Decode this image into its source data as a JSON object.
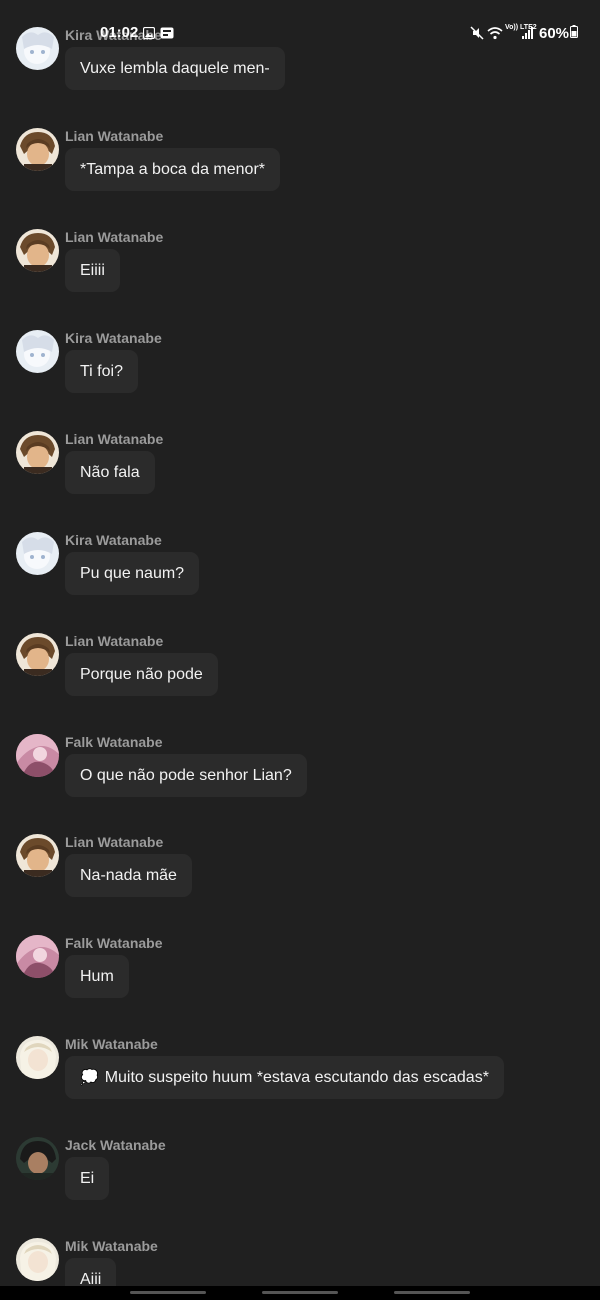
{
  "status_bar": {
    "time": "01:02",
    "battery": "60%",
    "network_label": "Vo)) LTE2"
  },
  "messages": [
    {
      "sender": "Kira Watanabe",
      "text": "Vuxe lembla daquele men-",
      "avatar": "kira"
    },
    {
      "sender": "Lian Watanabe",
      "text": "*Tampa a boca da menor*",
      "avatar": "lian"
    },
    {
      "sender": "Lian Watanabe",
      "text": "Eiiii",
      "avatar": "lian"
    },
    {
      "sender": "Kira Watanabe",
      "text": "Ti foi?",
      "avatar": "kira"
    },
    {
      "sender": "Lian Watanabe",
      "text": "Não fala",
      "avatar": "lian"
    },
    {
      "sender": "Kira Watanabe",
      "text": "Pu que naum?",
      "avatar": "kira"
    },
    {
      "sender": "Lian Watanabe",
      "text": "Porque não pode",
      "avatar": "lian"
    },
    {
      "sender": "Falk Watanabe",
      "text": "O que não pode senhor Lian?",
      "avatar": "falk"
    },
    {
      "sender": "Lian Watanabe",
      "text": "Na-nada mãe",
      "avatar": "lian"
    },
    {
      "sender": "Falk Watanabe",
      "text": "Hum",
      "avatar": "falk"
    },
    {
      "sender": "Mik Watanabe",
      "text": "Muito suspeito huum *estava escutando das escadas*",
      "avatar": "mik",
      "prefix_icon": "thought-bubble-icon"
    },
    {
      "sender": "Jack Watanabe",
      "text": "Ei",
      "avatar": "jack"
    },
    {
      "sender": "Mik Watanabe",
      "text": "Aiii",
      "avatar": "mik"
    }
  ],
  "colors": {
    "background": "#202020",
    "bubble": "#2b2b2b",
    "sender_text": "#9b9b9b",
    "message_text": "#f2f2f2"
  }
}
